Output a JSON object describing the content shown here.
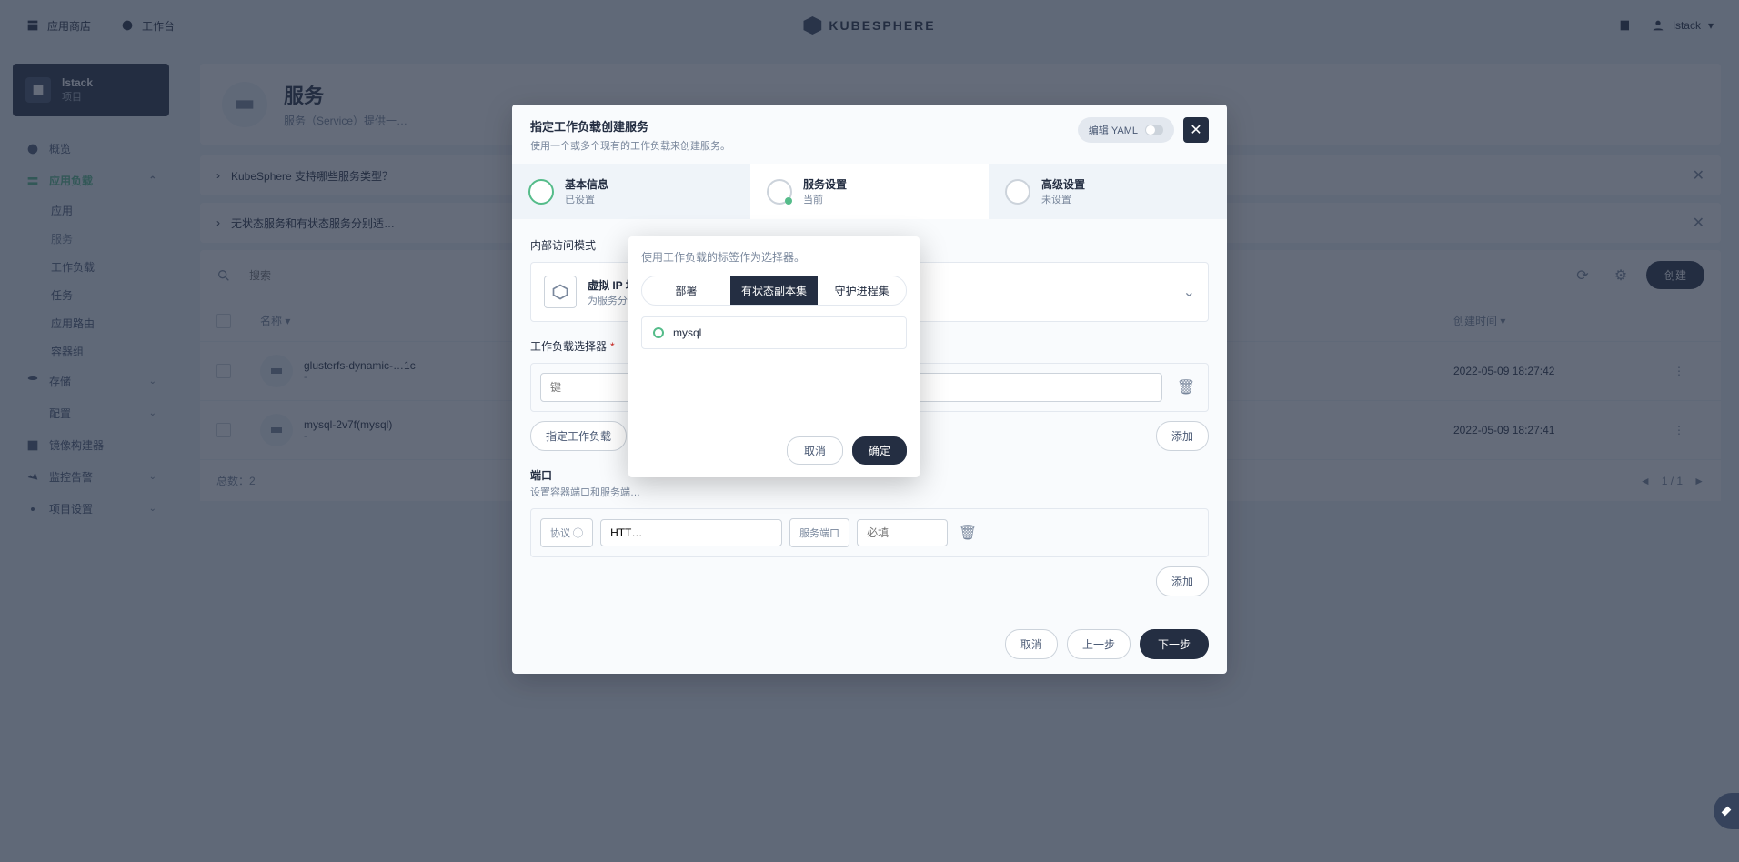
{
  "topnav": {
    "appstore": "应用商店",
    "workbench": "工作台",
    "brand": "KUBESPHERE",
    "user": "lstack"
  },
  "sidebar": {
    "project_name": "lstack",
    "project_label": "项目",
    "items": [
      {
        "label": "概览",
        "icon": "dashboard"
      },
      {
        "label": "应用负载",
        "icon": "workload",
        "active": true,
        "open": true,
        "children": [
          "应用",
          "服务",
          "工作负载",
          "任务",
          "应用路由",
          "容器组"
        ],
        "selected": "服务"
      },
      {
        "label": "存储",
        "icon": "storage"
      },
      {
        "label": "配置",
        "icon": "config"
      },
      {
        "label": "镜像构建器",
        "icon": "image"
      },
      {
        "label": "监控告警",
        "icon": "monitor"
      },
      {
        "label": "项目设置",
        "icon": "settings"
      }
    ]
  },
  "page": {
    "title": "服务",
    "desc": "服务（Service）提供一…"
  },
  "infobars": [
    "KubeSphere 支持哪些服务类型？",
    "无状态服务和有状态服务分别适…"
  ],
  "table": {
    "search_placeholder": "搜索",
    "create": "创建",
    "cols": {
      "name": "名称",
      "createtime": "创建时间"
    },
    "rows": [
      {
        "name": "glusterfs-dynamic-…1c",
        "sub": "-",
        "time": "2022-05-09 18:27:42"
      },
      {
        "name": "mysql-2v7f(mysql)",
        "sub": "-",
        "time": "2022-05-09 18:27:41"
      }
    ],
    "total_label": "总数：",
    "total": "2",
    "page": "1 / 1"
  },
  "modal": {
    "title": "指定工作负载创建服务",
    "subtitle": "使用一个或多个现有的工作负载来创建服务。",
    "yaml": "编辑 YAML",
    "steps": [
      {
        "title": "基本信息",
        "sub": "已设置",
        "state": "done"
      },
      {
        "title": "服务设置",
        "sub": "当前",
        "state": "active"
      },
      {
        "title": "高级设置",
        "sub": "未设置",
        "state": "pending"
      }
    ],
    "access_label": "内部访问模式",
    "access": {
      "title": "虚拟 IP 地址",
      "desc": "为服务分配虚…"
    },
    "selector_label": "工作负载选择器",
    "key_placeholder": "键",
    "specify_btn": "指定工作负载",
    "add_btn": "添加",
    "port_label": "端口",
    "port_desc": "设置容器端口和服务端…",
    "protocol_label": "协议",
    "protocol_value": "HTT…",
    "service_port_label": "服务端口",
    "service_port_placeholder": "必填",
    "foot": {
      "cancel": "取消",
      "prev": "上一步",
      "next": "下一步"
    }
  },
  "popover": {
    "hint": "使用工作负载的标签作为选择器。",
    "tabs": [
      "部署",
      "有状态副本集",
      "守护进程集"
    ],
    "items": [
      "mysql"
    ],
    "cancel": "取消",
    "ok": "确定"
  }
}
